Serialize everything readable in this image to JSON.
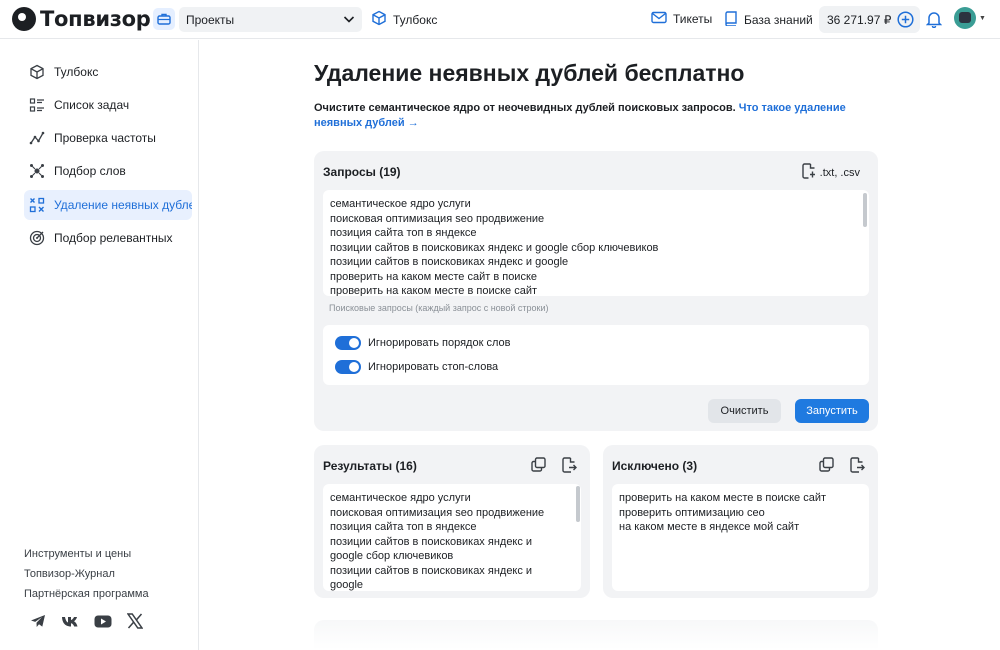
{
  "header": {
    "brand": "Топвизор",
    "project_select": "Проекты",
    "toolbox": "Тулбокс",
    "tickets": "Тикеты",
    "knowledge_base": "База знаний",
    "balance": "36 271.97 ₽"
  },
  "sidebar": {
    "items": [
      {
        "label": "Тулбокс",
        "icon": "cube-icon"
      },
      {
        "label": "Список задач",
        "icon": "list-icon"
      },
      {
        "label": "Проверка частоты",
        "icon": "frequency-icon"
      },
      {
        "label": "Подбор слов",
        "icon": "words-icon"
      },
      {
        "label": "Удаление неявных дублей",
        "icon": "duplicates-icon"
      },
      {
        "label": "Подбор релевантных",
        "icon": "target-icon"
      }
    ],
    "footer_links": [
      "Инструменты и цены",
      "Топвизор-Журнал",
      "Партнёрская программа"
    ],
    "socials": [
      "telegram-icon",
      "vk-icon",
      "youtube-icon",
      "x-icon"
    ]
  },
  "main": {
    "title": "Удаление неявных дублей бесплатно",
    "description": "Очистите семантическое ядро от неочевидных дублей поисковых запросов.",
    "description_link": "Что такое удаление неявных дублей →",
    "queries": {
      "title": "Запросы (19)",
      "upload_label": ".txt, .csv",
      "lines": [
        "семантическое ядро услуги",
        "поисковая оптимизация seo продвижение",
        "позиция сайта топ в яндексе",
        "позиции сайтов в поисковиках яндекс и google сбор ключевиков",
        "позиции сайтов в поисковиках яндекс и google",
        "проверить на каком месте сайт в поиске",
        "проверить на каком месте в поиске сайт"
      ],
      "hint": "Поисковые запросы (каждый запрос с новой строки)",
      "options": [
        "Игнорировать порядок слов",
        "Игнорировать стоп-слова"
      ],
      "clear_button": "Очистить",
      "run_button": "Запустить"
    },
    "results": {
      "title": "Результаты (16)",
      "lines": [
        "семантическое ядро услуги",
        "поисковая оптимизация seo продвижение",
        "позиция сайта топ в яндексе",
        "позиции сайтов в поисковиках яндекс и",
        "google сбор ключевиков",
        "позиции сайтов в поисковиках яндекс и",
        "google"
      ]
    },
    "excluded": {
      "title": "Исключено (3)",
      "lines": [
        "проверить на каком месте в поиске сайт",
        "проверить оптимизацию сео",
        "на каком месте в яндексе мой сайт"
      ]
    }
  },
  "colors": {
    "accent": "#1f7ae0",
    "active_bg": "#e8f0fe",
    "card_bg": "#f2f3f5"
  }
}
